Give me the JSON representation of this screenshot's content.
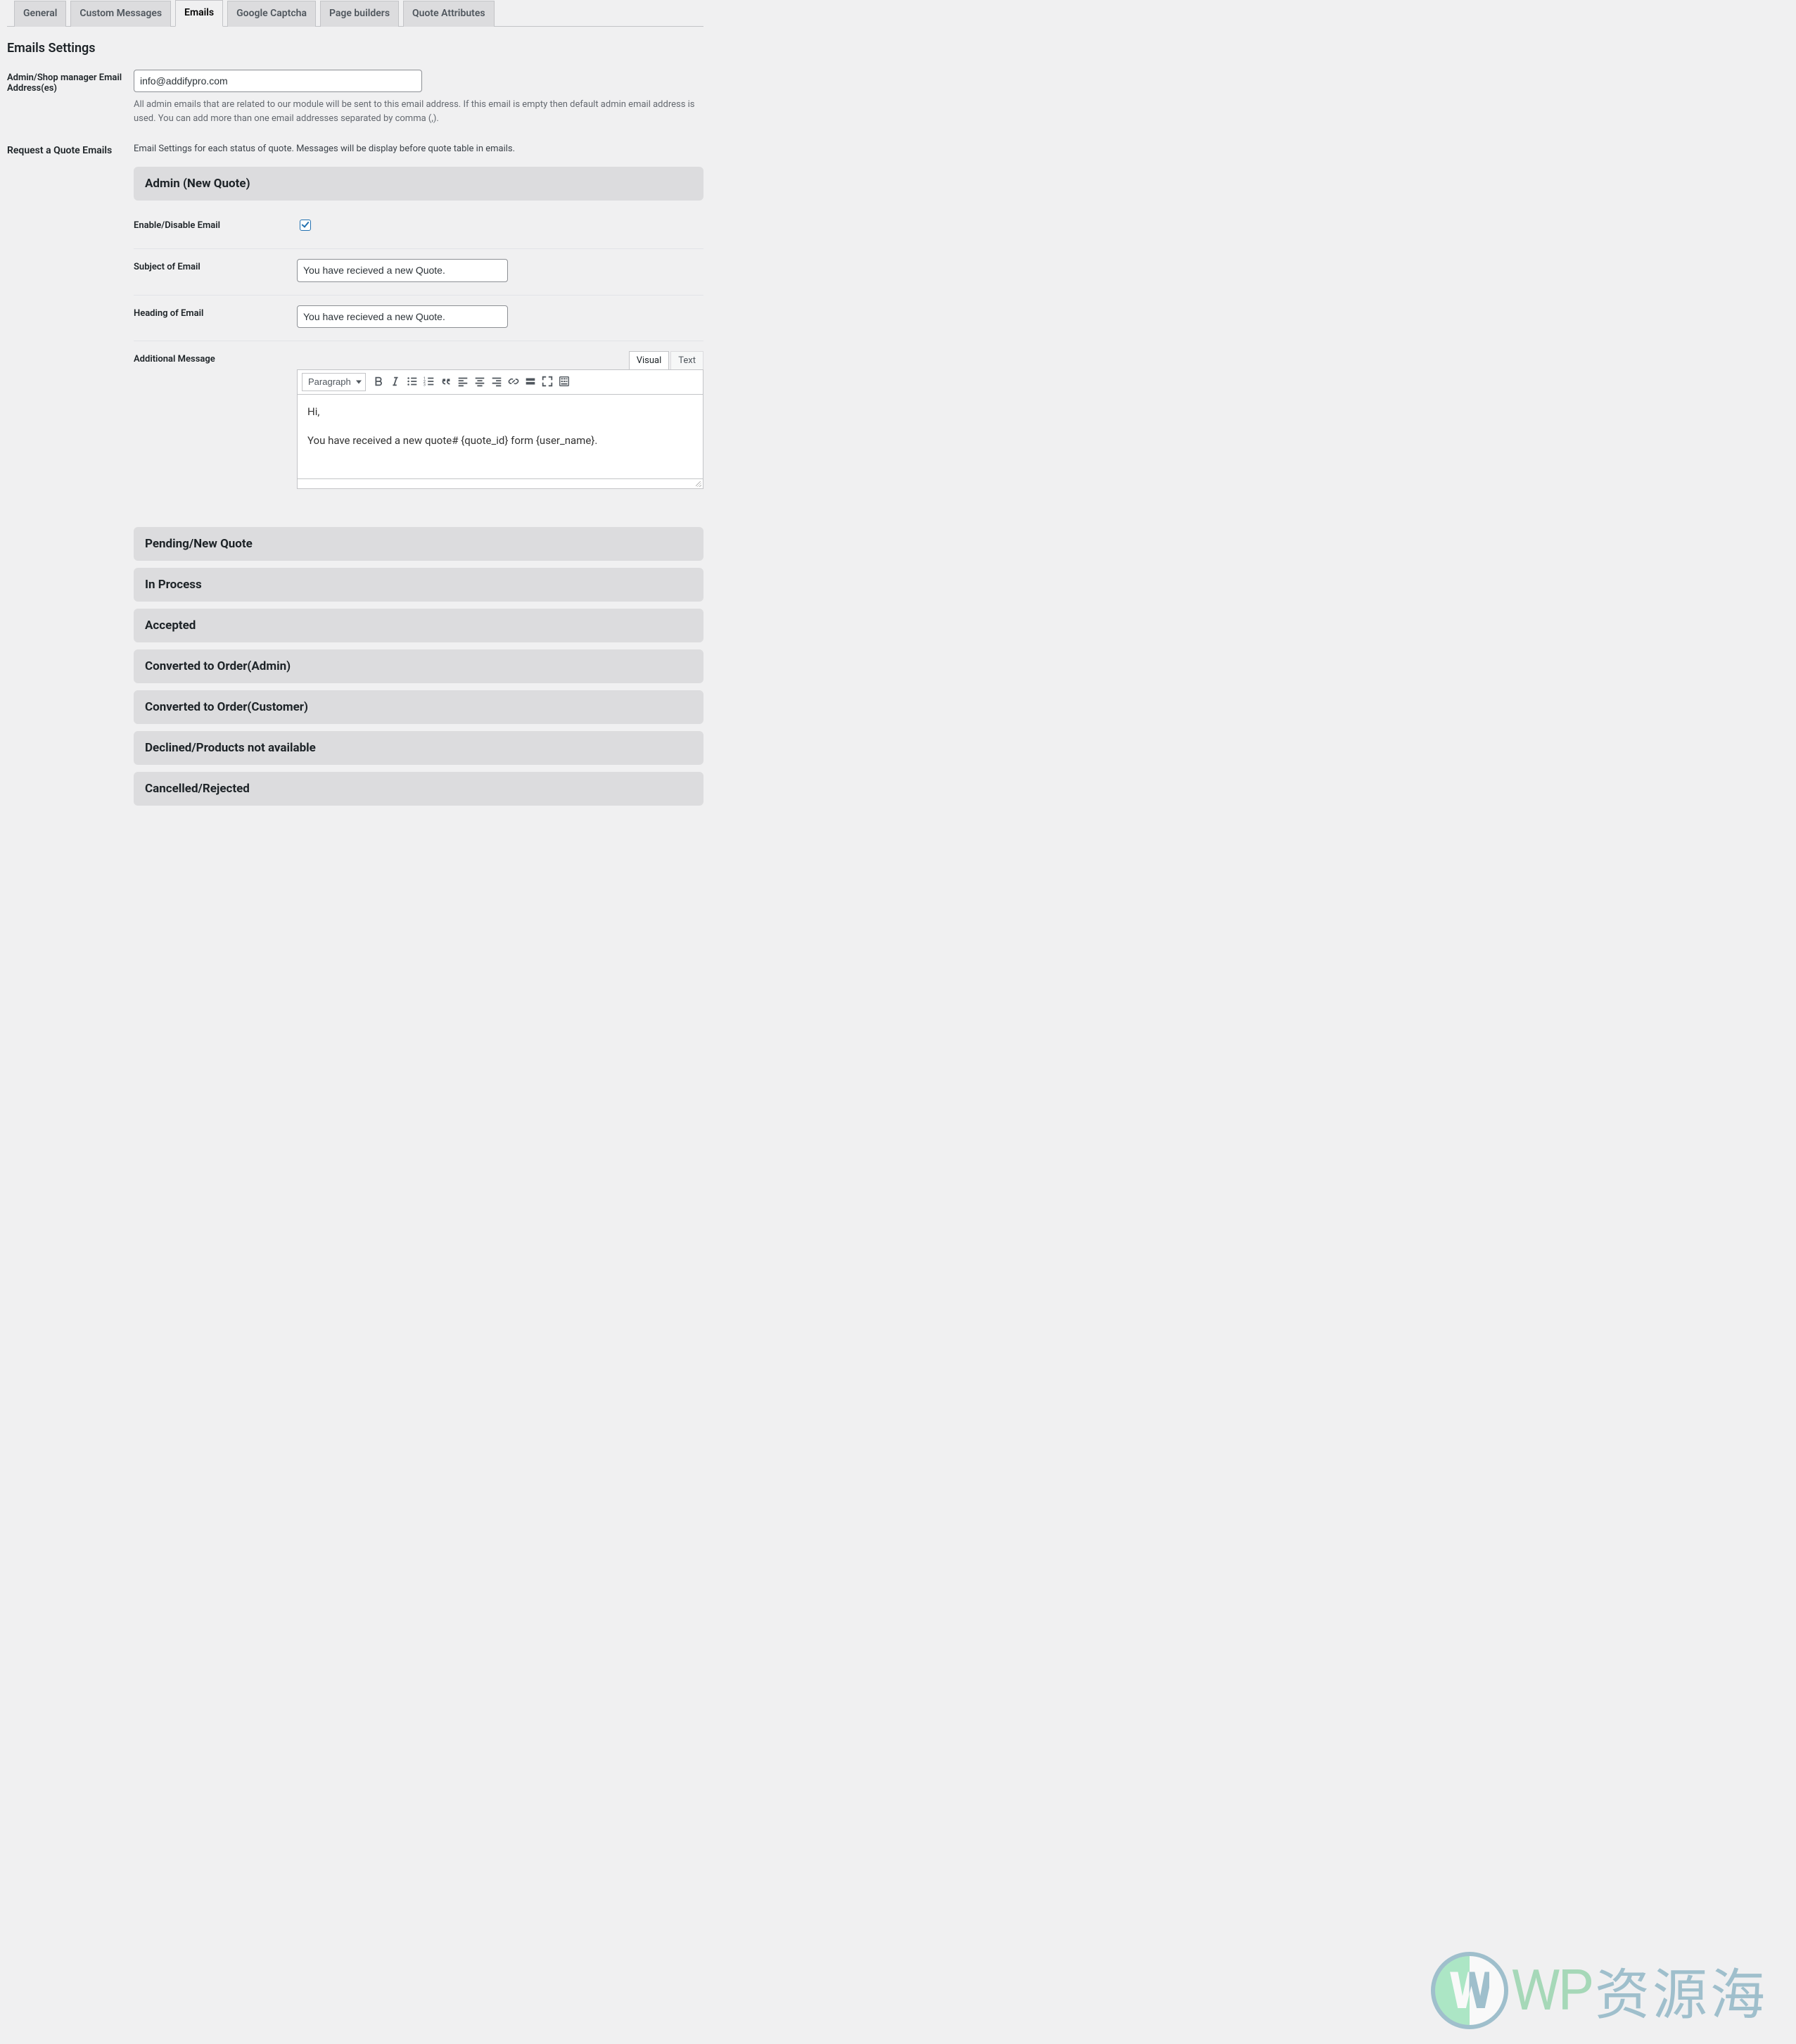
{
  "tabs": {
    "items": [
      {
        "label": "General"
      },
      {
        "label": "Custom Messages"
      },
      {
        "label": "Emails"
      },
      {
        "label": "Google Captcha"
      },
      {
        "label": "Page builders"
      },
      {
        "label": "Quote Attributes"
      }
    ],
    "active_index": 2
  },
  "page_title": "Emails Settings",
  "admin_email": {
    "label": "Admin/Shop manager Email Address(es)",
    "value": "info@addifypro.com",
    "help": "All admin emails that are related to our module will be sent to this email address. If this email is empty then default admin email address is used. You can add more than one email addresses separated by comma (,)."
  },
  "request_quote_emails": {
    "label": "Request a Quote Emails",
    "description": "Email Settings for each status of quote. Messages will be display before quote table in emails."
  },
  "admin_new_quote": {
    "title": "Admin (New Quote)",
    "fields": {
      "enable": {
        "label": "Enable/Disable Email",
        "checked": true
      },
      "subject": {
        "label": "Subject of Email",
        "value": "You have recieved a new Quote."
      },
      "heading": {
        "label": "Heading of Email",
        "value": "You have recieved a new Quote."
      },
      "message": {
        "label": "Additional Message"
      }
    },
    "editor": {
      "tabs": {
        "visual": "Visual",
        "text": "Text",
        "active": "visual"
      },
      "format": "Paragraph",
      "body": {
        "line1": "Hi,",
        "line2": "You have received a new quote# {quote_id} form {user_name}."
      },
      "toolbar": [
        {
          "name": "bold-icon",
          "title": "Bold"
        },
        {
          "name": "italic-icon",
          "title": "Italic"
        },
        {
          "name": "ul-icon",
          "title": "Bulleted list"
        },
        {
          "name": "ol-icon",
          "title": "Numbered list"
        },
        {
          "name": "quote-icon",
          "title": "Blockquote"
        },
        {
          "name": "alignleft-icon",
          "title": "Align left"
        },
        {
          "name": "aligncenter-icon",
          "title": "Align center"
        },
        {
          "name": "alignright-icon",
          "title": "Align right"
        },
        {
          "name": "link-icon",
          "title": "Insert link"
        },
        {
          "name": "readmore-icon",
          "title": "Insert Read More tag"
        },
        {
          "name": "fullscreen-icon",
          "title": "Fullscreen"
        },
        {
          "name": "kitchensink-icon",
          "title": "Toolbar Toggle"
        }
      ]
    }
  },
  "sections": [
    {
      "title": "Pending/New Quote"
    },
    {
      "title": "In Process"
    },
    {
      "title": "Accepted"
    },
    {
      "title": "Converted to Order(Admin)"
    },
    {
      "title": "Converted to Order(Customer)"
    },
    {
      "title": "Declined/Products not available"
    },
    {
      "title": "Cancelled/Rejected"
    }
  ],
  "watermark": {
    "wp": "WP",
    "cn": "资源海"
  }
}
